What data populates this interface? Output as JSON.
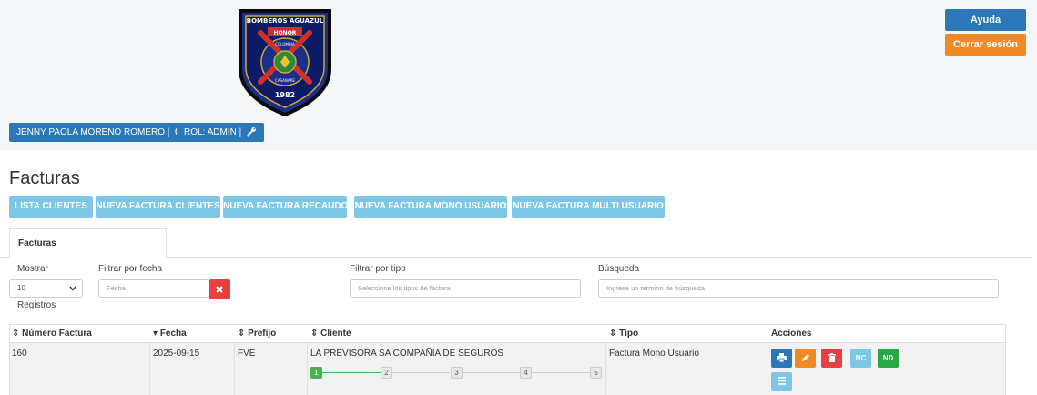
{
  "header": {
    "help_label": "Ayuda",
    "logout_label": "Cerrar sesión",
    "logo": {
      "ring_text": "BOMBEROS AGUAZUL",
      "banner_text": "HONOR",
      "inner_top": "COLOMBIA",
      "inner_bottom": "CASANARE",
      "year": "1982"
    },
    "user_name": "JENNY PAOLA MORENO ROMERO |",
    "role": "ROL: ADMIN |"
  },
  "page": {
    "title": "Facturas",
    "nav_buttons": [
      "LISTA CLIENTES",
      "NUEVA FACTURA CLIENTES",
      "NUEVA FACTURA RECAUDO",
      "NUEVA FACTURA MONO USUARIO",
      "NUEVA FACTURA MULTI USUARIO"
    ],
    "tab_label": "Facturas"
  },
  "filters": {
    "show_label": "Mostrar",
    "show_value": "10",
    "records_label": "Registros",
    "date_label": "Filtrar por fecha",
    "date_placeholder": "Fecha",
    "type_label": "Filtrar por tipo",
    "type_placeholder": "Seleccione los tipos de factura",
    "search_label": "Búsqueda",
    "search_placeholder": "Ingrese un termino de búsqueda"
  },
  "table": {
    "columns": [
      "Número Factura",
      "Fecha",
      "Prefijo",
      "Cliente",
      "Tipo",
      "Acciones"
    ],
    "rows": [
      {
        "numero": "160",
        "fecha": "2025-09-15",
        "prefijo": "FVE",
        "cliente": "LA PREVISORA SA COMPAÑIA DE SEGUROS",
        "tipo": "Factura Mono Usuario",
        "steps": [
          "1",
          "2",
          "3",
          "4",
          "5"
        ],
        "current_step": 1
      }
    ],
    "action_labels": {
      "nc": "NC",
      "nd": "ND"
    }
  },
  "colors": {
    "primary": "#2a78b7",
    "warning": "#f08a24",
    "info": "#7ec6e6",
    "danger": "#e64141",
    "success": "#4caf50"
  }
}
